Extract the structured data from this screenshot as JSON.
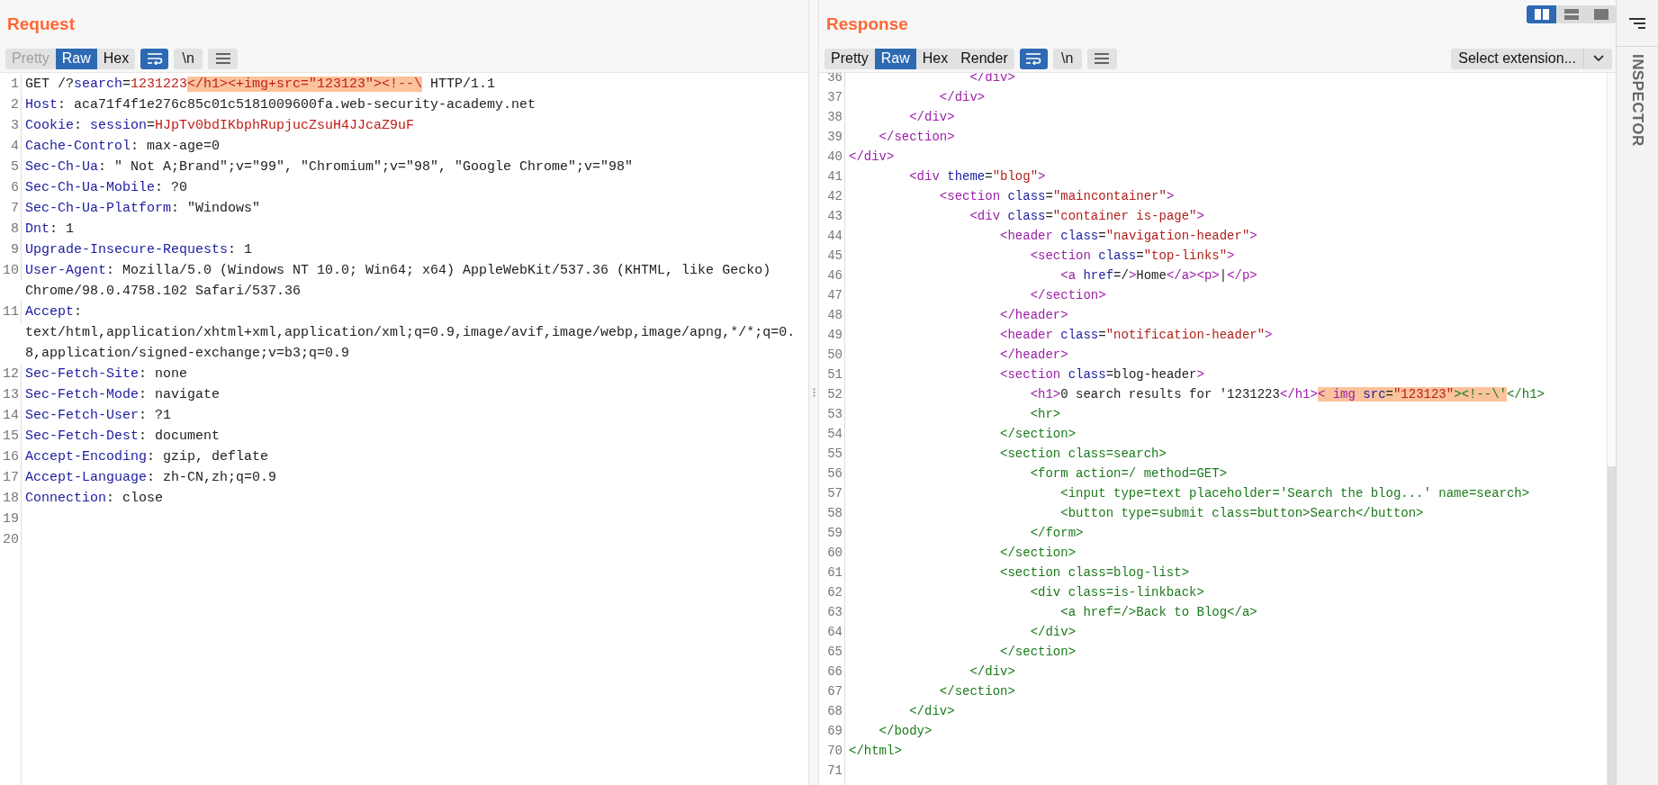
{
  "layout_buttons": [
    {
      "kind": "columns",
      "selected": true
    },
    {
      "kind": "rows",
      "selected": false
    },
    {
      "kind": "single",
      "selected": false
    }
  ],
  "request": {
    "title": "Request",
    "view_tabs": [
      {
        "label": "Pretty",
        "selected": false,
        "disabled": true
      },
      {
        "label": "Raw",
        "selected": true,
        "disabled": false
      },
      {
        "label": "Hex",
        "selected": false,
        "disabled": false
      }
    ],
    "wrap_enabled": true,
    "newline_button": "\\n",
    "lines": [
      {
        "number": "1",
        "segments": [
          {
            "text": "GET /?",
            "kind": "plain"
          },
          {
            "text": "search",
            "kind": "key"
          },
          {
            "text": "=",
            "kind": "plain"
          },
          {
            "text": "1231223",
            "kind": "value"
          },
          {
            "text": "</h1><+img+src=\"123123\"><!--\\",
            "kind": "mark"
          },
          {
            "text": " HTTP/1.1",
            "kind": "plain"
          }
        ]
      },
      {
        "number": "2",
        "segments": [
          {
            "text": "Host",
            "kind": "key"
          },
          {
            "text": ": aca71f4f1e276c85c01c5181009600fa.web-security-academy.net",
            "kind": "plain"
          }
        ]
      },
      {
        "number": "3",
        "segments": [
          {
            "text": "Cookie",
            "kind": "key"
          },
          {
            "text": ": ",
            "kind": "plain"
          },
          {
            "text": "session",
            "kind": "key"
          },
          {
            "text": "=",
            "kind": "plain"
          },
          {
            "text": "HJpTv0bdIKbphRupjucZsuH4JJcaZ9uF",
            "kind": "value"
          }
        ]
      },
      {
        "number": "4",
        "segments": [
          {
            "text": "Cache-Control",
            "kind": "key"
          },
          {
            "text": ": max-age=0",
            "kind": "plain"
          }
        ]
      },
      {
        "number": "5",
        "segments": [
          {
            "text": "Sec-Ch-Ua",
            "kind": "key"
          },
          {
            "text": ": \" Not A;Brand\";v=\"99\", \"Chromium\";v=\"98\", \"Google Chrome\";v=\"98\"",
            "kind": "plain"
          }
        ]
      },
      {
        "number": "6",
        "segments": [
          {
            "text": "Sec-Ch-Ua-Mobile",
            "kind": "key"
          },
          {
            "text": ": ?0",
            "kind": "plain"
          }
        ]
      },
      {
        "number": "7",
        "segments": [
          {
            "text": "Sec-Ch-Ua-Platform",
            "kind": "key"
          },
          {
            "text": ": \"Windows\"",
            "kind": "plain"
          }
        ]
      },
      {
        "number": "8",
        "segments": [
          {
            "text": "Dnt",
            "kind": "key"
          },
          {
            "text": ": 1",
            "kind": "plain"
          }
        ]
      },
      {
        "number": "9",
        "segments": [
          {
            "text": "Upgrade-Insecure-Requests",
            "kind": "key"
          },
          {
            "text": ": 1",
            "kind": "plain"
          }
        ]
      },
      {
        "number": "10",
        "segments": [
          {
            "text": "User-Agent",
            "kind": "key"
          },
          {
            "text": ": Mozilla/5.0 (Windows NT 10.0; Win64; x64) AppleWebKit/537.36 (KHTML, like Gecko) Chrome/98.0.4758.102 Safari/537.36",
            "kind": "plain"
          }
        ]
      },
      {
        "number": "11",
        "segments": [
          {
            "text": "Accept",
            "kind": "key"
          },
          {
            "text": ": text/html,application/xhtml+xml,application/xml;q=0.9,image/avif,image/webp,image/apng,*/*;q=0.8,application/signed-exchange;v=b3;q=0.9",
            "kind": "plain"
          }
        ]
      },
      {
        "number": "12",
        "segments": [
          {
            "text": "Sec-Fetch-Site",
            "kind": "key"
          },
          {
            "text": ": none",
            "kind": "plain"
          }
        ]
      },
      {
        "number": "13",
        "segments": [
          {
            "text": "Sec-Fetch-Mode",
            "kind": "key"
          },
          {
            "text": ": navigate",
            "kind": "plain"
          }
        ]
      },
      {
        "number": "14",
        "segments": [
          {
            "text": "Sec-Fetch-User",
            "kind": "key"
          },
          {
            "text": ": ?1",
            "kind": "plain"
          }
        ]
      },
      {
        "number": "15",
        "segments": [
          {
            "text": "Sec-Fetch-Dest",
            "kind": "key"
          },
          {
            "text": ": document",
            "kind": "plain"
          }
        ]
      },
      {
        "number": "16",
        "segments": [
          {
            "text": "Accept-Encoding",
            "kind": "key"
          },
          {
            "text": ": gzip, deflate",
            "kind": "plain"
          }
        ]
      },
      {
        "number": "17",
        "segments": [
          {
            "text": "Accept-Language",
            "kind": "key"
          },
          {
            "text": ": zh-CN,zh;q=0.9",
            "kind": "plain"
          }
        ]
      },
      {
        "number": "18",
        "segments": [
          {
            "text": "Connection",
            "kind": "key"
          },
          {
            "text": ": close",
            "kind": "plain"
          }
        ]
      },
      {
        "number": "19"
      },
      {
        "number": "20"
      }
    ]
  },
  "response": {
    "title": "Response",
    "view_tabs": [
      {
        "label": "Pretty",
        "selected": false,
        "disabled": false
      },
      {
        "label": "Raw",
        "selected": true,
        "disabled": false
      },
      {
        "label": "Hex",
        "selected": false,
        "disabled": false
      },
      {
        "label": "Render",
        "selected": false,
        "disabled": false
      }
    ],
    "wrap_enabled": true,
    "newline_button": "\\n",
    "extension_select": "Select extension...",
    "lines": [
      {
        "number": "36",
        "segments": [
          {
            "text": "                </div>",
            "kind": "tag"
          }
        ]
      },
      {
        "number": "37",
        "segments": [
          {
            "text": "            </div>",
            "kind": "tag"
          }
        ]
      },
      {
        "number": "38",
        "segments": [
          {
            "text": "        </div>",
            "kind": "tag"
          }
        ]
      },
      {
        "number": "39",
        "segments": [
          {
            "text": "    </section>",
            "kind": "tag"
          }
        ]
      },
      {
        "number": "40",
        "segments": [
          {
            "text": "</div>",
            "kind": "tag"
          }
        ]
      },
      {
        "number": "41",
        "segments": [
          {
            "text": "        <div",
            "kind": "tag"
          },
          {
            "text": " theme",
            "kind": "attr"
          },
          {
            "text": "=",
            "kind": "plain"
          },
          {
            "text": "\"blog\"",
            "kind": "string"
          },
          {
            "text": ">",
            "kind": "tag"
          }
        ]
      },
      {
        "number": "42",
        "segments": [
          {
            "text": "            <section",
            "kind": "tag"
          },
          {
            "text": " class",
            "kind": "attr"
          },
          {
            "text": "=",
            "kind": "plain"
          },
          {
            "text": "\"maincontainer\"",
            "kind": "string"
          },
          {
            "text": ">",
            "kind": "tag"
          }
        ]
      },
      {
        "number": "43",
        "segments": [
          {
            "text": "                <div",
            "kind": "tag"
          },
          {
            "text": " class",
            "kind": "attr"
          },
          {
            "text": "=",
            "kind": "plain"
          },
          {
            "text": "\"container is-page\"",
            "kind": "string"
          },
          {
            "text": ">",
            "kind": "tag"
          }
        ]
      },
      {
        "number": "44",
        "segments": [
          {
            "text": "                    <header",
            "kind": "tag"
          },
          {
            "text": " class",
            "kind": "attr"
          },
          {
            "text": "=",
            "kind": "plain"
          },
          {
            "text": "\"navigation-header\"",
            "kind": "string"
          },
          {
            "text": ">",
            "kind": "tag"
          }
        ]
      },
      {
        "number": "45",
        "segments": [
          {
            "text": "                        <section",
            "kind": "tag"
          },
          {
            "text": " class",
            "kind": "attr"
          },
          {
            "text": "=",
            "kind": "plain"
          },
          {
            "text": "\"top-links\"",
            "kind": "string"
          },
          {
            "text": ">",
            "kind": "tag"
          }
        ]
      },
      {
        "number": "46",
        "segments": [
          {
            "text": "                            <a",
            "kind": "tag"
          },
          {
            "text": " href",
            "kind": "attr"
          },
          {
            "text": "=/",
            "kind": "plain"
          },
          {
            "text": ">",
            "kind": "tag"
          },
          {
            "text": "Home",
            "kind": "plain"
          },
          {
            "text": "</a><p>",
            "kind": "tag"
          },
          {
            "text": "|",
            "kind": "plain"
          },
          {
            "text": "</p>",
            "kind": "tag"
          }
        ]
      },
      {
        "number": "47",
        "segments": [
          {
            "text": "                        </section>",
            "kind": "tag"
          }
        ]
      },
      {
        "number": "48",
        "segments": [
          {
            "text": "                    </header>",
            "kind": "tag"
          }
        ]
      },
      {
        "number": "49",
        "segments": [
          {
            "text": "                    <header",
            "kind": "tag"
          },
          {
            "text": " class",
            "kind": "attr"
          },
          {
            "text": "=",
            "kind": "plain"
          },
          {
            "text": "\"notification-header\"",
            "kind": "string"
          },
          {
            "text": ">",
            "kind": "tag"
          }
        ]
      },
      {
        "number": "50",
        "segments": [
          {
            "text": "                    </header>",
            "kind": "tag"
          }
        ]
      },
      {
        "number": "51",
        "segments": [
          {
            "text": "                    <section",
            "kind": "tag"
          },
          {
            "text": " class",
            "kind": "attr"
          },
          {
            "text": "=blog-header",
            "kind": "plain"
          },
          {
            "text": ">",
            "kind": "tag"
          }
        ]
      },
      {
        "number": "52",
        "segments": [
          {
            "text": "                        <h1>",
            "kind": "tag"
          },
          {
            "text": "0 search results for '1231223",
            "kind": "plain"
          },
          {
            "text": "</h1>",
            "kind": "tag"
          },
          {
            "text": "< img",
            "kind": "mark_tag"
          },
          {
            "text": " src",
            "kind": "mark_attr"
          },
          {
            "text": "=",
            "kind": "mark_plain"
          },
          {
            "text": "\"123123\"",
            "kind": "mark_string"
          },
          {
            "text": "><!--\\'",
            "kind": "mark_comment"
          },
          {
            "text": "</h1>",
            "kind": "comment"
          }
        ]
      },
      {
        "number": "53",
        "segments": [
          {
            "text": "                        <hr>",
            "kind": "comment"
          }
        ]
      },
      {
        "number": "54",
        "segments": [
          {
            "text": "                    </section>",
            "kind": "comment"
          }
        ]
      },
      {
        "number": "55",
        "segments": [
          {
            "text": "                    <section class=search>",
            "kind": "comment"
          }
        ]
      },
      {
        "number": "56",
        "segments": [
          {
            "text": "                        <form action=/ method=GET>",
            "kind": "comment"
          }
        ]
      },
      {
        "number": "57",
        "segments": [
          {
            "text": "                            <input type=text placeholder='Search the blog...' name=search>",
            "kind": "comment"
          }
        ]
      },
      {
        "number": "58",
        "segments": [
          {
            "text": "                            <button type=submit class=button>Search</button>",
            "kind": "comment"
          }
        ]
      },
      {
        "number": "59",
        "segments": [
          {
            "text": "                        </form>",
            "kind": "comment"
          }
        ]
      },
      {
        "number": "60",
        "segments": [
          {
            "text": "                    </section>",
            "kind": "comment"
          }
        ]
      },
      {
        "number": "61",
        "segments": [
          {
            "text": "                    <section class=blog-list>",
            "kind": "comment"
          }
        ]
      },
      {
        "number": "62",
        "segments": [
          {
            "text": "                        <div class=is-linkback>",
            "kind": "comment"
          }
        ]
      },
      {
        "number": "63",
        "segments": [
          {
            "text": "                            <a href=/>Back to Blog</a>",
            "kind": "comment"
          }
        ]
      },
      {
        "number": "64",
        "segments": [
          {
            "text": "                        </div>",
            "kind": "comment"
          }
        ]
      },
      {
        "number": "65",
        "segments": [
          {
            "text": "                    </section>",
            "kind": "comment"
          }
        ]
      },
      {
        "number": "66",
        "segments": [
          {
            "text": "                </div>",
            "kind": "comment"
          }
        ]
      },
      {
        "number": "67",
        "segments": [
          {
            "text": "            </section>",
            "kind": "comment"
          }
        ]
      },
      {
        "number": "68",
        "segments": [
          {
            "text": "        </div>",
            "kind": "comment"
          }
        ]
      },
      {
        "number": "69",
        "segments": [
          {
            "text": "    </body>",
            "kind": "comment"
          }
        ]
      },
      {
        "number": "70",
        "segments": [
          {
            "text": "</html>",
            "kind": "comment"
          }
        ]
      },
      {
        "number": "71"
      }
    ]
  },
  "inspector": {
    "label": "INSPECTOR"
  }
}
